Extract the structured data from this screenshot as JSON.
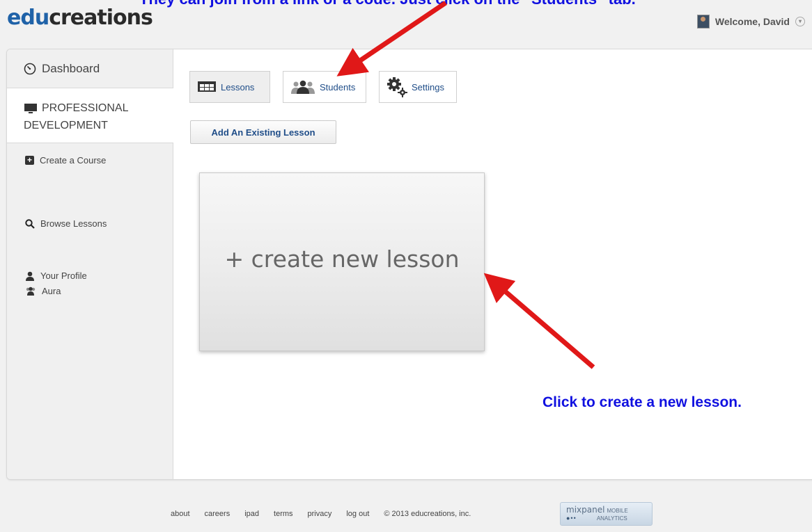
{
  "header": {
    "logo_prefix": "edu",
    "logo_suffix": "creations",
    "welcome": "Welcome, David"
  },
  "annotations": {
    "top": "They can join from a link or a code. Just click on the \"Students\" tab.",
    "right": "Click to create a new lesson."
  },
  "sidebar": {
    "dashboard": "Dashboard",
    "course_line1": "PROFESSIONAL",
    "course_line2": "DEVELOPMENT",
    "create_course": "Create a Course",
    "browse_lessons": "Browse Lessons",
    "your_profile": "Your Profile",
    "student_name": "Aura"
  },
  "tabs": {
    "lessons": "Lessons",
    "students": "Students",
    "settings": "Settings"
  },
  "main": {
    "add_existing": "Add An Existing Lesson",
    "create_new": "+ create new lesson"
  },
  "footer": {
    "links": [
      "about",
      "careers",
      "ipad",
      "terms",
      "privacy",
      "log out"
    ],
    "copyright": "© 2013 educreations, inc.",
    "badge_name": "mixpanel",
    "badge_mobile": "MOBILE",
    "badge_analytics": "ANALYTICS"
  },
  "colors": {
    "annotation": "#1010e0",
    "arrow": "#e01818",
    "link": "#1f4d88"
  }
}
